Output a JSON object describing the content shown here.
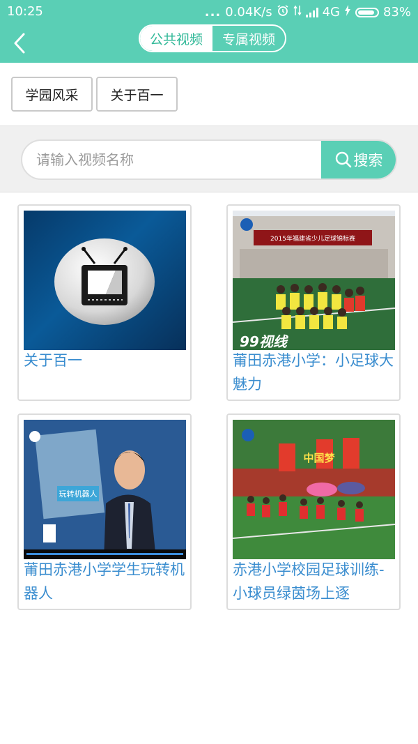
{
  "status_bar": {
    "time": "10:25",
    "dots": "...",
    "network_speed": "0.04K/s",
    "network_type": "4G",
    "battery": "83%",
    "icons": [
      "alarm-icon",
      "data-transfer-icon",
      "signal-icon",
      "charging-icon",
      "battery-icon"
    ]
  },
  "nav": {
    "back_icon": "chevron-left-icon",
    "tabs": [
      {
        "label": "公共视频",
        "active": true
      },
      {
        "label": "专属视频",
        "active": false
      }
    ]
  },
  "categories": [
    {
      "label": "学园风采"
    },
    {
      "label": "关于百一"
    }
  ],
  "search": {
    "placeholder": "请输入视频名称",
    "button_label": "搜索",
    "button_icon": "search-icon"
  },
  "videos": [
    {
      "title": "关于百一",
      "thumb": "tv-icon"
    },
    {
      "title": "莆田赤港小学：小足球大魅力",
      "thumb": "football-team-photo",
      "thumb_text": "2015年福建省少儿足球锦标赛",
      "watermark": "99视线"
    },
    {
      "title": "莆田赤港小学学生玩转机器人",
      "thumb": "news-anchor-photo",
      "thumb_text": "玩转机器人"
    },
    {
      "title": "赤港小学校园足球训练-小球员绿茵场上逐",
      "thumb": "chinese-dream-photo",
      "thumb_text": "中国梦"
    }
  ],
  "colors": {
    "accent": "#5acfb5",
    "link": "#3a8dcf",
    "border": "#dcdcdc"
  }
}
